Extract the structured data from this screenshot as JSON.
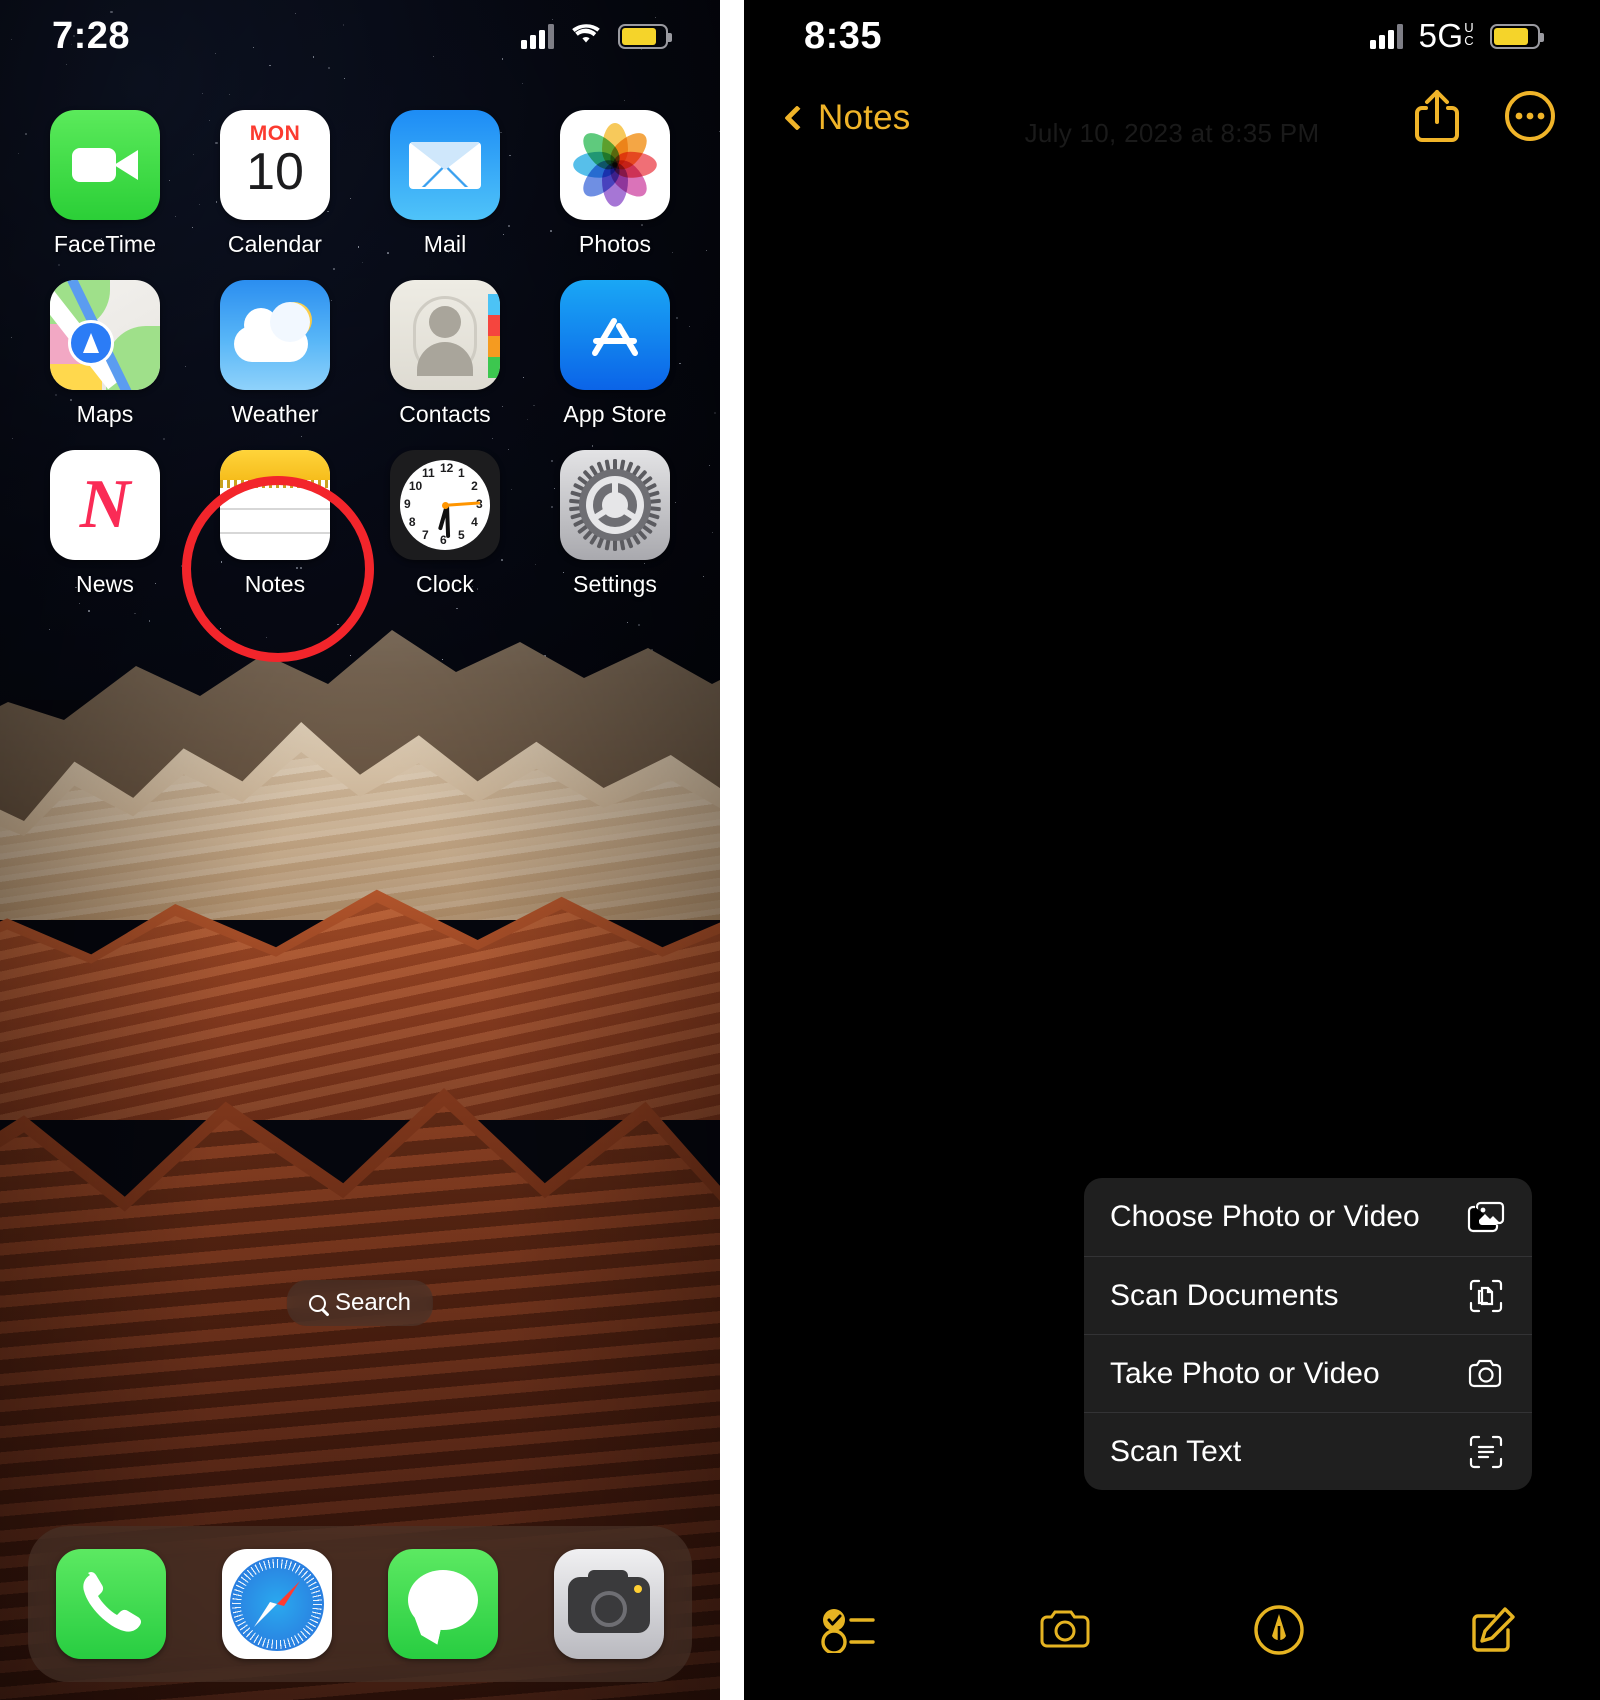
{
  "left_screen": {
    "status_bar": {
      "time": "7:28",
      "cellular_icon": "cellular-bars-icon",
      "wifi_icon": "wifi-icon",
      "battery_icon": "battery-icon"
    },
    "app_rows": [
      [
        {
          "label": "FaceTime",
          "icon": "facetime-icon"
        },
        {
          "label": "Calendar",
          "icon": "calendar-icon",
          "weekday": "MON",
          "day": "10"
        },
        {
          "label": "Mail",
          "icon": "mail-icon"
        },
        {
          "label": "Photos",
          "icon": "photos-icon"
        }
      ],
      [
        {
          "label": "Maps",
          "icon": "maps-icon"
        },
        {
          "label": "Weather",
          "icon": "weather-icon"
        },
        {
          "label": "Contacts",
          "icon": "contacts-icon"
        },
        {
          "label": "App Store",
          "icon": "app-store-icon"
        }
      ],
      [
        {
          "label": "News",
          "icon": "news-icon"
        },
        {
          "label": "Notes",
          "icon": "notes-icon"
        },
        {
          "label": "Clock",
          "icon": "clock-icon"
        },
        {
          "label": "Settings",
          "icon": "settings-icon"
        }
      ]
    ],
    "search": {
      "label": "Search",
      "icon": "search-icon"
    },
    "dock": [
      {
        "label": "Phone",
        "icon": "phone-icon"
      },
      {
        "label": "Safari",
        "icon": "safari-icon"
      },
      {
        "label": "Messages",
        "icon": "messages-icon"
      },
      {
        "label": "Camera",
        "icon": "camera-icon"
      }
    ],
    "highlight": {
      "target": "Notes",
      "shape": "ellipse",
      "color": "#f3252b"
    }
  },
  "right_screen": {
    "status_bar": {
      "time": "8:35",
      "cellular_icon": "cellular-bars-icon",
      "network": "5G",
      "network_sup": "U",
      "network_sub": "C",
      "battery_icon": "battery-icon"
    },
    "nav": {
      "back_label": "Notes",
      "back_icon": "chevron-left-icon",
      "share_icon": "share-icon",
      "more_icon": "more-circle-icon"
    },
    "note": {
      "date": "July 10, 2023 at 8:35 PM"
    },
    "action_sheet": {
      "items": [
        {
          "label": "Choose Photo or Video",
          "icon": "photo-stack-icon"
        },
        {
          "label": "Scan Documents",
          "icon": "scan-document-icon"
        },
        {
          "label": "Take Photo or Video",
          "icon": "camera-icon"
        },
        {
          "label": "Scan Text",
          "icon": "scan-text-icon"
        }
      ]
    },
    "highlight": {
      "target": "Scan Documents",
      "shape": "ellipse",
      "color": "#f3252b"
    },
    "toolbar": [
      {
        "label": "Checklist",
        "icon": "checklist-icon"
      },
      {
        "label": "Camera",
        "icon": "camera-icon"
      },
      {
        "label": "Markup",
        "icon": "markup-pen-icon"
      },
      {
        "label": "New Note",
        "icon": "compose-icon"
      }
    ]
  },
  "colors": {
    "accent_yellow": "#f0b429",
    "highlight_red": "#f3252b",
    "sheet_bg": "#1f1f1f"
  }
}
